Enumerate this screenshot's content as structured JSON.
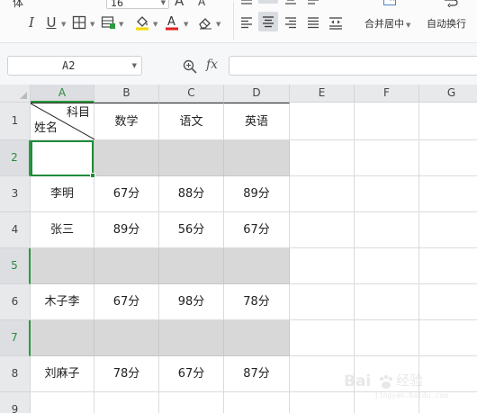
{
  "ribbon": {
    "font_name_fragment": "体",
    "font_size": "16",
    "grow_font_label": "A",
    "shrink_font_label": "A",
    "italic_label": "I",
    "underline_label": "U",
    "merge_center_label": "合并居中",
    "auto_wrap_label": "自动换行",
    "accent_colors": {
      "font_color": "#e02020",
      "highlight": "#f5d800",
      "merge_icon": "#4a86c6"
    }
  },
  "formula_bar": {
    "name_box": "A2",
    "fx_label": "fx",
    "formula_value": ""
  },
  "sheet": {
    "columns": [
      "A",
      "B",
      "C",
      "D",
      "E",
      "F",
      "G"
    ],
    "selected_column": "A",
    "rows": [
      "1",
      "2",
      "3",
      "4",
      "5",
      "6",
      "7",
      "8",
      "9"
    ],
    "selected_rows": [
      "2",
      "5",
      "7"
    ],
    "active_cell": "A2",
    "header_cell_subject": "科目",
    "header_cell_name": "姓名",
    "header_subjects": [
      "数学",
      "语文",
      "英语"
    ],
    "records": [
      {
        "name": "李明",
        "scores": [
          "67分",
          "88分",
          "89分"
        ]
      },
      {
        "name": "张三",
        "scores": [
          "89分",
          "56分",
          "67分"
        ]
      },
      {
        "name": "木子李",
        "scores": [
          "67分",
          "98分",
          "78分"
        ]
      },
      {
        "name": "刘麻子",
        "scores": [
          "78分",
          "67分",
          "87分"
        ]
      }
    ],
    "grid_color": "#dadbdd",
    "highlight_row_color": "#d8d8d8",
    "selection_color": "#1f8b3a"
  },
  "watermark": {
    "brand_text": "经验",
    "url": "jingyan.baidu.com"
  }
}
